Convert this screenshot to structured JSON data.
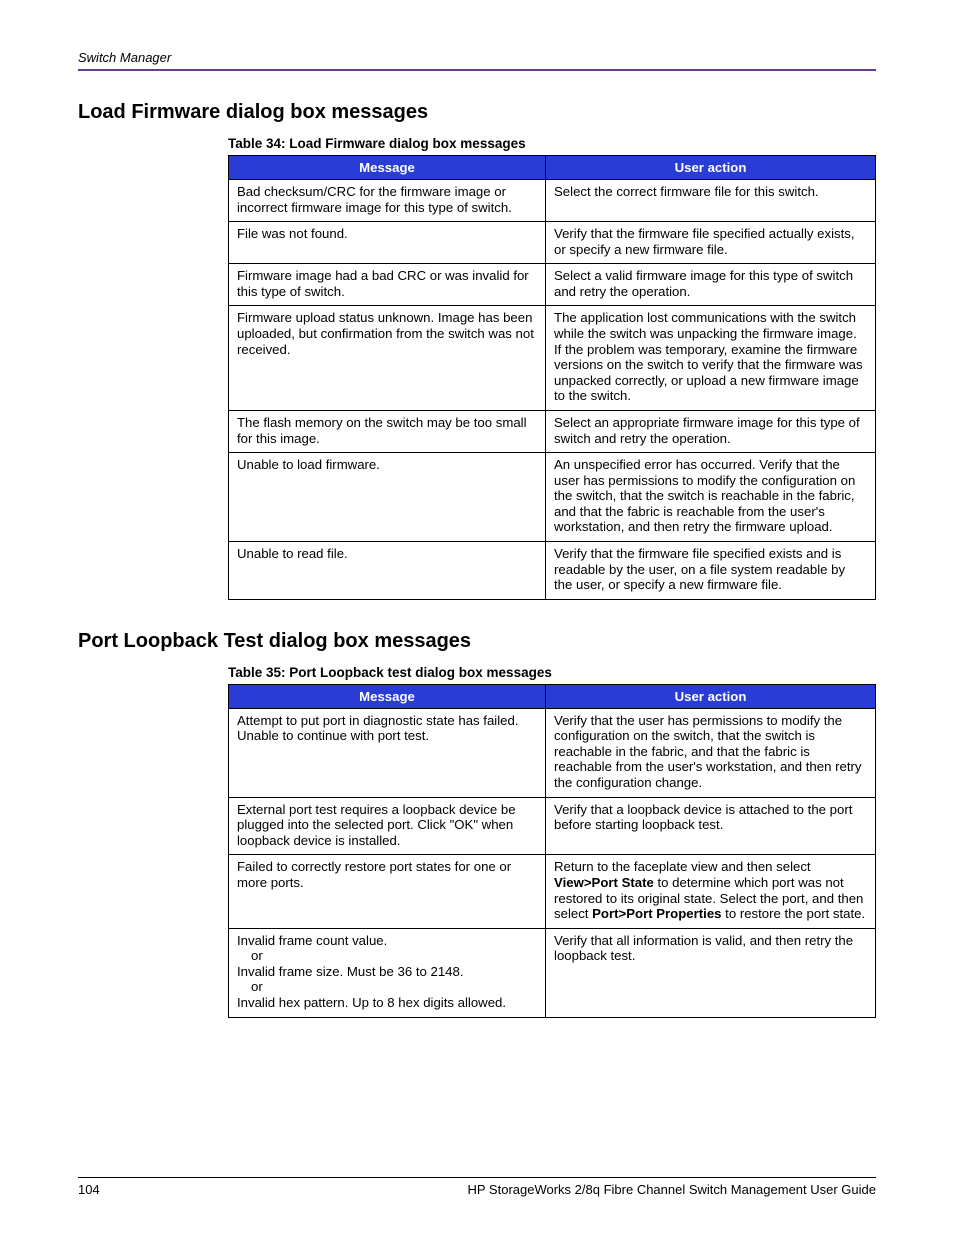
{
  "running_head": "Switch Manager",
  "section1": {
    "title": "Load Firmware dialog box messages",
    "caption_prefix": "Table 34:  ",
    "caption_text": "Load Firmware dialog box messages",
    "col_message": "Message",
    "col_action": "User action",
    "rows": [
      {
        "msg": "Bad checksum/CRC for the firmware image or incorrect firmware image for this type of switch.",
        "act": "Select the correct firmware file for this switch."
      },
      {
        "msg": "File was not found.",
        "act": "Verify that the firmware file specified actually exists, or specify a new firmware file."
      },
      {
        "msg": "Firmware image had a bad CRC or was invalid for this type of switch.",
        "act": "Select a valid firmware image for this type of switch and retry the operation."
      },
      {
        "msg": "Firmware upload status unknown. Image has been uploaded, but confirmation from the switch was not received.",
        "act": "The application lost communications with the switch while the switch was unpacking the firmware image. If the problem was temporary, examine the firmware versions on the switch to verify that the firmware was unpacked correctly, or upload a new firmware image to the switch."
      },
      {
        "msg": "The flash memory on the switch may be too small for this image.",
        "act": "Select an appropriate firmware image for this type of switch and retry the operation."
      },
      {
        "msg": "Unable to load firmware.",
        "act": "An unspecified error has occurred. Verify that the user has permissions to modify the configuration on the switch, that the switch is reachable in the fabric, and that the fabric is reachable from the user's workstation, and then retry the firmware upload."
      },
      {
        "msg": "Unable to read file.",
        "act": "Verify that the firmware file specified exists and is readable by the user, on a file system readable by the user, or specify a new firmware file."
      }
    ]
  },
  "section2": {
    "title": "Port Loopback Test dialog box messages",
    "caption_prefix": "Table 35:  ",
    "caption_text": "Port Loopback test dialog box messages",
    "col_message": "Message",
    "col_action": "User action",
    "rows_simple": [
      {
        "msg": "Attempt to put port in diagnostic state has failed. Unable to continue with port test.",
        "act": "Verify that the user has permissions to modify the configuration on the switch, that the switch is reachable in the fabric, and that the fabric is reachable from the user's workstation, and then retry the configuration change."
      },
      {
        "msg": "External port test requires a loopback device be plugged into the selected port. Click \"OK\" when loopback device is installed.",
        "act": "Verify that a loopback device is attached to the port before starting loopback test."
      }
    ],
    "row_rich": {
      "msg": "Failed to correctly restore port states for one or more ports.",
      "act_pre": "Return to the faceplate view and then select ",
      "act_b1": "View>Port State",
      "act_mid": " to determine which port was not restored to its original state. Select the port, and then select ",
      "act_b2": "Port>Port Properties",
      "act_post": " to restore the port state."
    },
    "row_multi": {
      "l1": "Invalid frame count value.",
      "or": "or",
      "l2": "Invalid frame size. Must be 36 to 2148.",
      "l3": "Invalid hex pattern. Up to 8 hex digits allowed.",
      "act": "Verify that all information is valid, and then retry the loopback test."
    }
  },
  "footer": {
    "page": "104",
    "doc": "HP StorageWorks 2/8q Fibre Channel Switch Management User Guide"
  }
}
